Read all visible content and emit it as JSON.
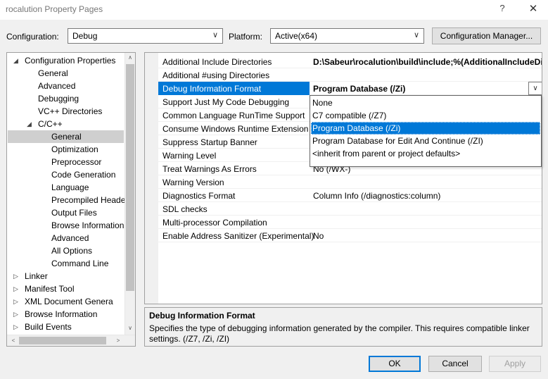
{
  "window": {
    "title": "rocalution Property Pages",
    "help_glyph": "?",
    "close_glyph": "✕"
  },
  "config": {
    "configuration_label": "Configuration:",
    "configuration_value": "Debug",
    "platform_label": "Platform:",
    "platform_value": "Active(x64)",
    "manager_button": "Configuration Manager..."
  },
  "tree": {
    "items": [
      {
        "label": "Configuration Properties",
        "toggle": "◢"
      },
      {
        "label": "General"
      },
      {
        "label": "Advanced"
      },
      {
        "label": "Debugging"
      },
      {
        "label": "VC++ Directories"
      },
      {
        "label": "C/C++",
        "toggle": "◢"
      },
      {
        "label": "General",
        "selected": true
      },
      {
        "label": "Optimization"
      },
      {
        "label": "Preprocessor"
      },
      {
        "label": "Code Generation"
      },
      {
        "label": "Language"
      },
      {
        "label": "Precompiled Heade"
      },
      {
        "label": "Output Files"
      },
      {
        "label": "Browse Information"
      },
      {
        "label": "Advanced"
      },
      {
        "label": "All Options"
      },
      {
        "label": "Command Line"
      },
      {
        "label": "Linker",
        "toggle": "▷"
      },
      {
        "label": "Manifest Tool",
        "toggle": "▷"
      },
      {
        "label": "XML Document Genera",
        "toggle": "▷"
      },
      {
        "label": "Browse Information",
        "toggle": "▷"
      },
      {
        "label": "Build Events",
        "toggle": "▷"
      }
    ]
  },
  "properties": {
    "rows": [
      {
        "name": "Additional Include Directories",
        "value": "D:\\Sabeur\\rocalution\\build\\include;%(AdditionalIncludeDir",
        "bold": true
      },
      {
        "name": "Additional #using Directories",
        "value": ""
      },
      {
        "name": "Debug Information Format",
        "value": "Program Database (/Zi)",
        "bold": true,
        "selected": true
      },
      {
        "name": "Support Just My Code Debugging",
        "value": ""
      },
      {
        "name": "Common Language RunTime Support",
        "value": ""
      },
      {
        "name": "Consume Windows Runtime Extension",
        "value": ""
      },
      {
        "name": "Suppress Startup Banner",
        "value": ""
      },
      {
        "name": "Warning Level",
        "value": ""
      },
      {
        "name": "Treat Warnings As Errors",
        "value": "No (/WX-)"
      },
      {
        "name": "Warning Version",
        "value": ""
      },
      {
        "name": "Diagnostics Format",
        "value": "Column Info (/diagnostics:column)"
      },
      {
        "name": "SDL checks",
        "value": ""
      },
      {
        "name": "Multi-processor Compilation",
        "value": ""
      },
      {
        "name": "Enable Address Sanitizer (Experimental)",
        "value": "No"
      }
    ],
    "dropdown_glyph": "∨"
  },
  "dropdown": {
    "options": [
      {
        "label": "None"
      },
      {
        "label": "C7 compatible (/Z7)"
      },
      {
        "label": "Program Database (/Zi)",
        "selected": true
      },
      {
        "label": "Program Database for Edit And Continue (/ZI)"
      },
      {
        "label": "<inherit from parent or project defaults>"
      }
    ]
  },
  "description": {
    "title": "Debug Information Format",
    "text": "Specifies the type of debugging information generated by the compiler.  This requires compatible linker settings.    (/Z7, /Zi, /ZI)"
  },
  "buttons": {
    "ok": "OK",
    "cancel": "Cancel",
    "apply": "Apply"
  },
  "colors": {
    "accent": "#0078d7",
    "tree_selected": "#cfcfcf"
  }
}
